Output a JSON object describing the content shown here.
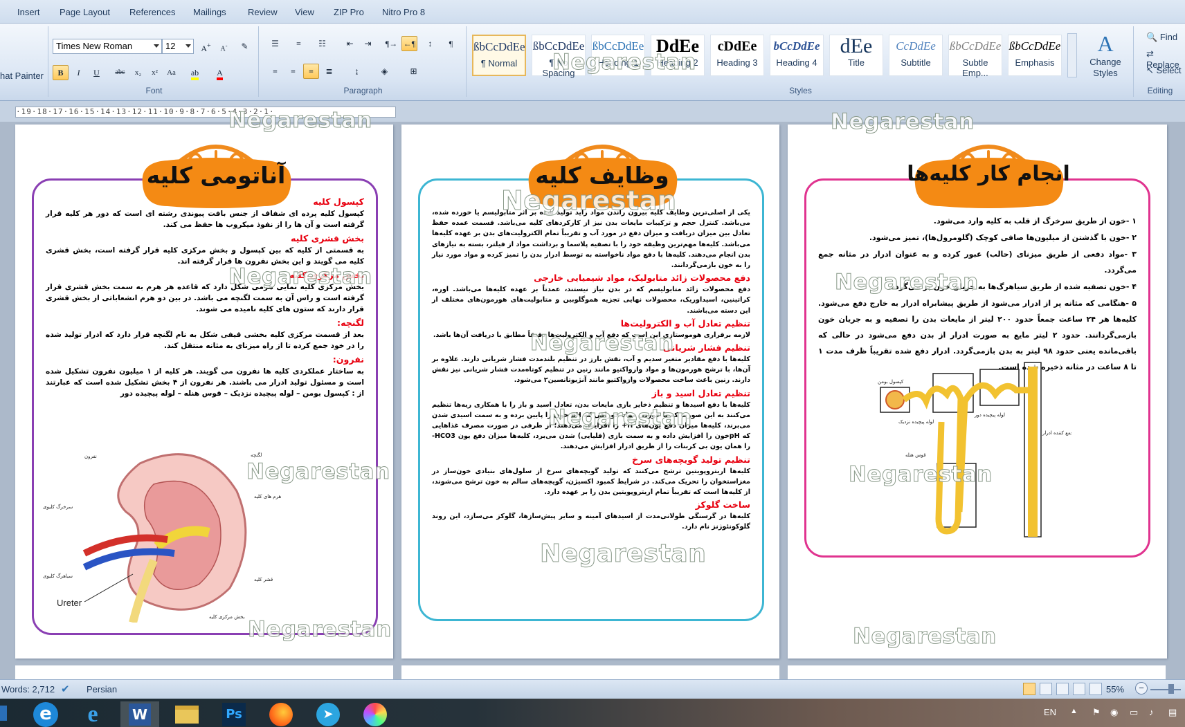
{
  "ribbon": {
    "tabs": [
      "Insert",
      "Page Layout",
      "References",
      "Mailings",
      "Review",
      "View",
      "ZIP Pro",
      "Nitro Pro 8"
    ],
    "clipboard": {
      "format_painter": "hat Painter"
    },
    "font": {
      "name": "Times New Roman",
      "size": "12",
      "group_label": "Font"
    },
    "paragraph": {
      "group_label": "Paragraph"
    },
    "styles": {
      "group_label": "Styles",
      "items": [
        {
          "sample": "ßbCcDdEe",
          "name": "¶ Normal"
        },
        {
          "sample": "ßbCcDdEe",
          "name": "¶ No Spacing"
        },
        {
          "sample": "ßbCcDdEe",
          "name": "Heading 1"
        },
        {
          "sample": "DdEe",
          "name": "Heading 2"
        },
        {
          "sample": "cDdEe",
          "name": "Heading 3"
        },
        {
          "sample": "bCcDdEe",
          "name": "Heading 4"
        },
        {
          "sample": "dEe",
          "name": "Title"
        },
        {
          "sample": "CcDdEe",
          "name": "Subtitle"
        },
        {
          "sample": "ßbCcDdEe",
          "name": "Subtle Emp..."
        },
        {
          "sample": "ßbCcDdEe",
          "name": "Emphasis"
        }
      ],
      "change_styles": "Change Styles"
    },
    "editing": {
      "group_label": "Editing",
      "find": "Find",
      "replace": "Replace",
      "select": "Select"
    }
  },
  "ruler": {
    "marks": "·19·18·17·16·15·14·13·12·11·10·9·8·7·6·5·4·3·2·1·"
  },
  "pages": [
    {
      "title": "آناتومی کلیه",
      "paragraphs": [
        {
          "h": "کپسول کلیه",
          "t": "کپسول کلیه پرده ای شفاف از جنس بافت پیوندی رشته ای است که دور هر کلیه قرار گرفته است و آن ها را از نفوذ میکروب ها حفظ می کند."
        },
        {
          "h": "بخش قشری کلیه",
          "t": "به قسمتی از کلیه که بین کپسول و بخش مرکزی کلیه قرار گرفته است، بخش قشری کلیه می گویند و این بخش نفرون ها قرار گرفته اند."
        },
        {
          "h": "بخش مرکزی کلیه",
          "t": "بخش مرکزی کلیه نمایی هرمی شکل دارد که قاعده هر هرم به سمت بخش قشری قرار گرفته است و راس آن به سمت لگنچه می باشد. در بین دو هرم انشعاباتی از بخش قشری قرار دارند که ستون های کلیه نامیده می شوند."
        },
        {
          "h": "لگنچه:",
          "t": "بعد از قسمت مرکزی کلیه بخشی قیفی شکل به نام لگنچه قرار دارد که ادرار تولید شده را در خود جمع کرده تا از راه میزنای به مثانه منتقل کند."
        },
        {
          "h": "نفرون:",
          "t": "به ساختار عملکردی کلیه ها نفرون می گویند. هر کلیه از ۱ میلیون نفرون تشکیل شده است و مسئول تولید ادرار می باشند. هر نفرون از ۴ بخش تشکیل شده است که عبارتند از : کپسول بومن – لوله پیچیده نزدیک – قوس هنله – لوله پیچیده دور"
        }
      ],
      "figure": {
        "ureter_label": "Ureter",
        "labels": [
          "نفرون",
          "سرخرگ کلیوی",
          "سیاهرگ کلیوی",
          "لگنچه",
          "هرم های کلیه",
          "قشر کلیه",
          "بخش مرکزی کلیه"
        ]
      }
    },
    {
      "title": "وظایف کلیه",
      "paragraphs": [
        {
          "h": "",
          "t": "یکی از اصلی‌ترین وظایف کلیه بیرون راندن مواد زاید تولید شده بر اثر متابولیسم یا خورده شده، می‌باشد. کنترل حجم و ترکیبات مایعات بدن نیز از کارکردهای کلیه می‌باشد. قسمت عمده حفظ تعادل بین میزان دریافت و میزان دفع در مورد آب و تقریباً تمام الکترولیت‌های بدن بر عهده کلیه‌ها می‌باشد. کلیه‌ها مهم‌ترین وظیفه خود را با تصفیه پلاسما و برداشت مواد از فیلتر، بسته به نیازهای بدن انجام می‌دهند. کلیه‌ها با دفع مواد ناخواسته به توسط ادرار بدن را تمیز کرده و مواد مورد نیاز را به خون بازمی‌گردانند."
        },
        {
          "h": "دفع محصولات زائد متابولیک، مواد شیمیایی خارجی",
          "t": "دفع محصولات زائد متابولیسم که در بدن نیاز نیستند، عمدتاً بر عهده کلیه‌ها می‌باشد. اوره، کراتینین، اسیداوریک، محصولات نهایی تجزیه هموگلوبین و متابولیت‌های هورمون‌های مختلف از این دسته می‌باشند."
        },
        {
          "h": "تنظیم تعادل آب و الکترولیت‌ها",
          "t": "لازمه برقراری هوموستازی این است که دفع آب و الکترولیت‌ها دقیقاً مطابق با دریافت آن‌ها باشد."
        },
        {
          "h": "تنظیم فشار شریانی",
          "t": "کلیه‌ها با دفع مقادیر متغیر سدیم و آب، نقش بارز در تنظیم بلندمدت فشار شریانی دارند. علاوه بر آن‌ها، با ترشح هورمون‌ها و مواد وازواکتیو مانند رنین در تنظیم کوتاه‌مدت فشار شریانی نیز نقش دارند. رنین باعث ساخت محصولات وازواکتیو مانند آنژیوتانسین۲ می‌شود."
        },
        {
          "h": "تنظیم تعادل اسید و باز",
          "t": "کلیه‌ها با دفع اسیدها و تنظیم ذخایر بازی مایعات بدن، تعادل اسید و باز را با همکاری ریه‌ها تنظیم می‌کنند به این صورت که با خوردن مواد خوراکی که pH خون را پایین برده و به سمت اسیدی شدن می‌برند، کلیه‌ها میزان دفع یون‌های H+ را افزایش می‌دهند؛ از طرفی در صورت مصرف غذاهایی که pHخون را افزایش داده و به سمت بازی (قلیایی) شدن می‌برد، کلیه‌ها میزان دفع یون HCO3- را همان یون بی کربنات را از طریق ادرار افزایش می‌دهند."
        },
        {
          "h": "تنظیم تولید گویچه‌های سرخ",
          "t": "کلیه‌ها اریتروپویتین ترشح می‌کنند که تولید گویچه‌های سرخ از سلول‌های بنیادی خون‌ساز در مغزاستخوان را تحریک می‌کند. در شرایط کمبود اکسیژن، گویچه‌های سالم به خون ترشح می‌شوند، از کلیه‌ها است که تقریباً تمام اریتروپویتین بدن را بر عهده دارد."
        },
        {
          "h": "ساخت گلوکز",
          "t": "کلیه‌ها در گرسنگی طولانی‌مدت از اسیدهای آمینه و سایر پیش‌سازها، گلوکز می‌سازد، این روند گلوکونئوژنز نام دارد."
        }
      ]
    },
    {
      "title": "انجام کار کلیه‌ها",
      "paragraphs": [
        {
          "h": "",
          "t": "۱ -خون از طریق سرخرگ از قلب به کلیه وارد می‌شود."
        },
        {
          "h": "",
          "t": "۲ -خون با گذشتن از میلیون‌ها صافی کوچک (گلومرول‌ها)، تمیز می‌شود."
        },
        {
          "h": "",
          "t": "۳ -مواد دفعی از طریق میزنای (حالب) عبور کرده و به عنوان ادرار در مثانه جمع می‌گردد."
        },
        {
          "h": "",
          "t": "۴ -خون تصفیه شده از طریق سیاهرگ‌ها به جریان خون بر می‌گردد."
        },
        {
          "h": "",
          "t": "۵ -هنگامی که مثانه پر از ادرار می‌شود از طریق پیشابراه ادرار به خارج دفع می‌شود. کلیه‌ها هر ۲۴ ساعت جمعاً حدود ۲۰۰ لیتر از مایعات بدن را تصفیه و به جریان خون بازمی‌گردانند. حدود ۲ لیتر مایع به صورت ادرار از بدن دفع می‌شود در حالی که باقی‌مانده یعنی حدود ۹۸ لیتر به بدن بازمی‌گردد. ادرار دفع شده تقریباً ظرف مدت ۱ تا ۸ ساعت در مثانه ذخیره شده است."
        }
      ],
      "figure": {
        "labels": [
          "کپسول بومن",
          "لوله پیچیده نزدیک",
          "لوله پیچیده دور",
          "قوس هنله",
          "مجرای جمع کننده ادرار"
        ]
      }
    }
  ],
  "watermark": "Negarestan",
  "status": {
    "words": "Words: 2,712",
    "language": "Persian",
    "zoom": "55%"
  },
  "taskbar": {
    "lang": "EN",
    "apps": [
      "ie-blue-e-icon",
      "internet-explorer-icon",
      "word-icon",
      "file-explorer-icon",
      "photoshop-icon",
      "firefox-icon",
      "telegram-icon",
      "paint-icon"
    ]
  }
}
